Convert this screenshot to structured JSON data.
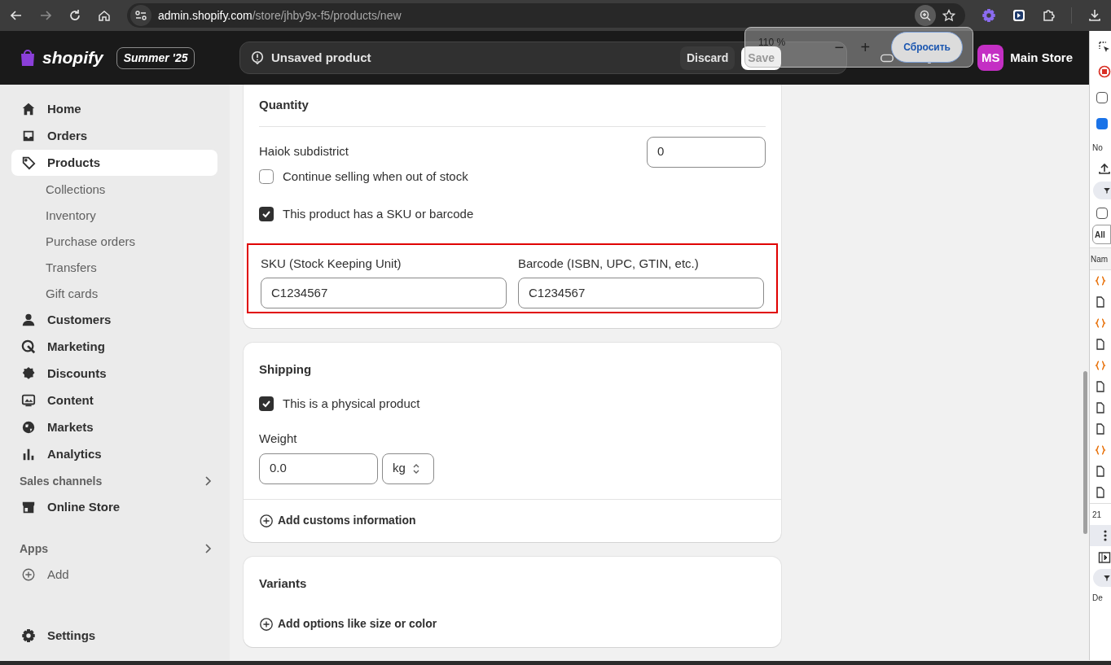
{
  "browser": {
    "url_host": "admin.shopify.com",
    "url_path": "/store/jhby9x-f5/products/new",
    "zoom_popup": {
      "level": "110 %",
      "minus": "−",
      "plus": "+",
      "reset": "Сбросить"
    }
  },
  "header": {
    "logo": "shopify",
    "badge": "Summer '25",
    "status": "Unsaved product",
    "buttons": [
      "Discard",
      "Save"
    ],
    "store": {
      "initials": "MS",
      "name": "Main Store"
    }
  },
  "sidebar": {
    "items": [
      {
        "label": "Home",
        "selected": false
      },
      {
        "label": "Orders",
        "selected": false
      },
      {
        "label": "Products",
        "selected": true,
        "children": [
          {
            "label": "Collections"
          },
          {
            "label": "Inventory"
          },
          {
            "label": "Purchase orders"
          },
          {
            "label": "Transfers"
          },
          {
            "label": "Gift cards"
          }
        ]
      },
      {
        "label": "Customers",
        "selected": false
      },
      {
        "label": "Marketing",
        "selected": false
      },
      {
        "label": "Discounts",
        "selected": false
      },
      {
        "label": "Content",
        "selected": false
      },
      {
        "label": "Markets",
        "selected": false
      },
      {
        "label": "Analytics",
        "selected": false
      }
    ],
    "sections": [
      {
        "title": "Sales channels",
        "items": [
          {
            "label": "Online Store"
          }
        ]
      },
      {
        "title": "Apps",
        "items": [
          {
            "label": "Add"
          }
        ]
      }
    ],
    "settings": "Settings"
  },
  "quantity": {
    "title": "Quantity",
    "location": "Haiok subdistrict",
    "value": "0",
    "checkboxes": [
      {
        "label": "Continue selling when out of stock",
        "checked": false
      },
      {
        "label": "This product has a SKU or barcode",
        "checked": true
      }
    ],
    "codes": {
      "highlighted": true,
      "fields": [
        {
          "label": "SKU (Stock Keeping Unit)",
          "value": "C1234567"
        },
        {
          "label": "Barcode (ISBN, UPC, GTIN, etc.)",
          "value": "C1234567"
        }
      ]
    }
  },
  "shipping": {
    "title": "Shipping",
    "physical": {
      "label": "This is a physical product",
      "checked": true
    },
    "weight_label": "Weight",
    "weight": "0.0",
    "unit": "kg",
    "link": "Add customs information"
  },
  "variants": {
    "title": "Variants",
    "link": "Add options like size or color"
  },
  "devtools": {
    "texts": [
      "No",
      "All",
      "Nam",
      "21",
      "De"
    ],
    "checkboxes": [
      {
        "checked": false
      },
      {
        "checked": true
      },
      {
        "checked": false
      }
    ]
  }
}
